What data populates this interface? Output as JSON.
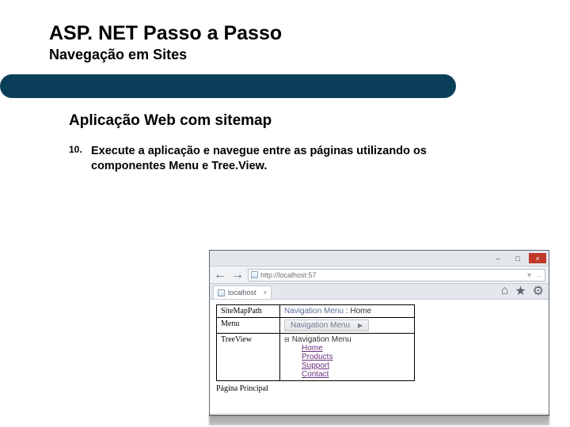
{
  "title": "ASP. NET Passo a Passo",
  "subtitle": "Navegação em Sites",
  "section_title": "Aplicação Web com sitemap",
  "step": {
    "number": "10.",
    "text_line1": "Execute a aplicação e navegue entre as páginas utilizando os",
    "text_line2": "componentes Menu e Tree.View."
  },
  "browser": {
    "win_min": "–",
    "win_max": "□",
    "win_close": "×",
    "nav_back": "←",
    "nav_fwd": "→",
    "url_text": "http://localhost:57",
    "url_arrow": "▼",
    "url_search": "→",
    "tab_label": "localhost",
    "tab_close": "×",
    "home_icon": "⌂",
    "star_icon": "★",
    "gear_icon": "⚙"
  },
  "labels": {
    "sitemappath": "SiteMapPath",
    "menu": "Menu",
    "treeview": "TreeView"
  },
  "controls": {
    "crumb_prefix": "Navigation Menu",
    "crumb_sep": ":",
    "crumb_current": "Home",
    "menu_button": "Navigation Menu",
    "menu_arrow": "▶",
    "tree_toggle": "⊟",
    "tree_root": "Navigation Menu",
    "tree_children": [
      "Home",
      "Products",
      "Support",
      "Contact"
    ]
  },
  "footer": "Página Principal"
}
